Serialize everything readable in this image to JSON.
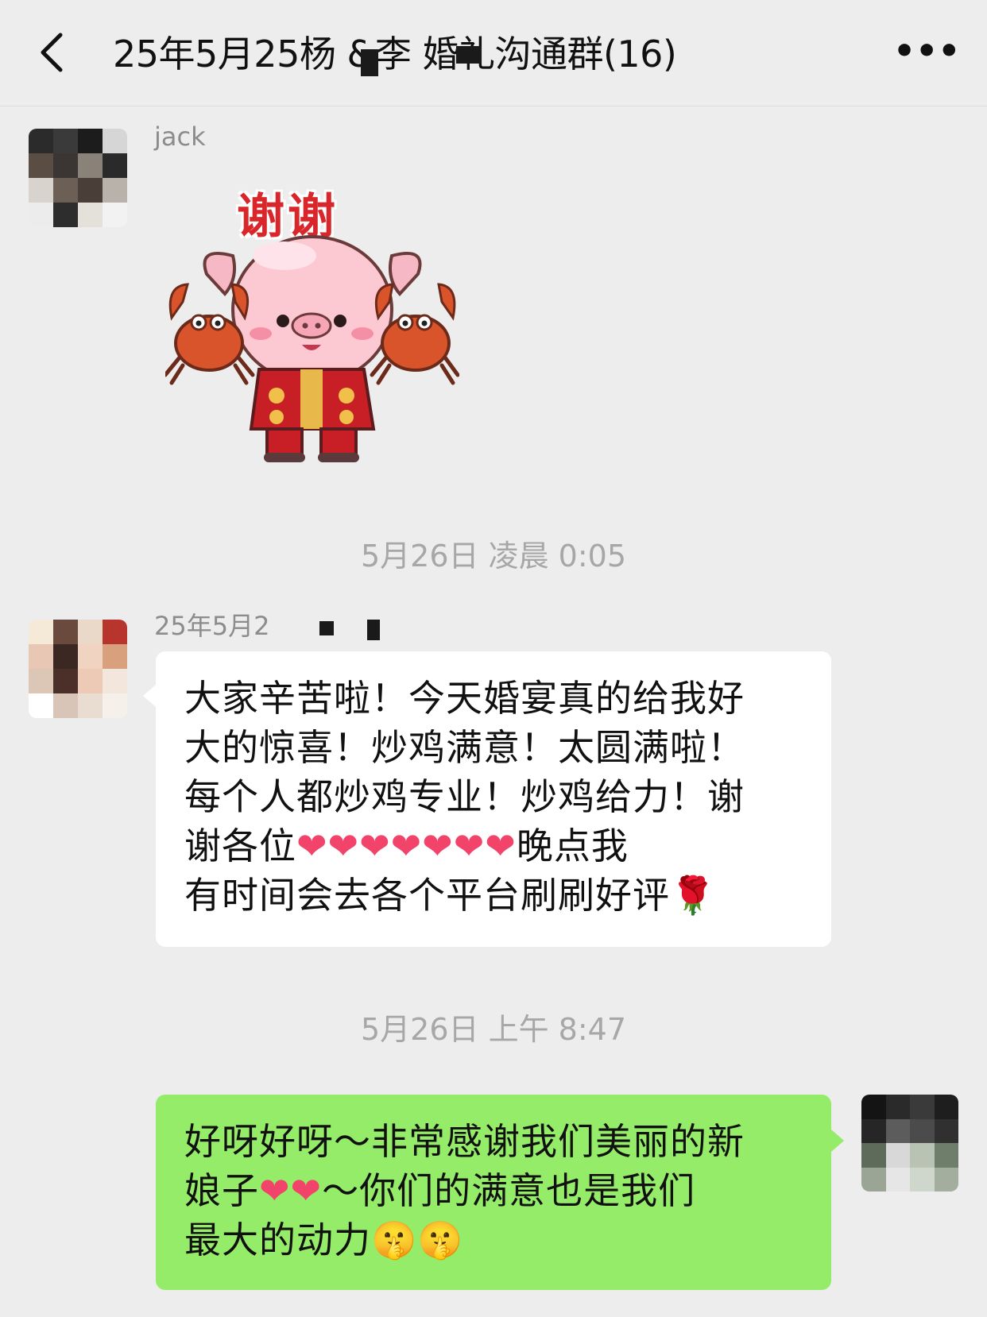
{
  "nav": {
    "back_icon": "chevron-left-icon",
    "title": "25年5月25杨 &李 婚礼沟通群(16)",
    "more_label": "•••"
  },
  "messages": [
    {
      "sender": "jack",
      "type": "sticker",
      "sticker_text": "谢谢",
      "sticker_icon": "pig-with-crabs-sticker"
    },
    {
      "timestamp": "5月26日 凌晨 0:05"
    },
    {
      "sender": "25年5月2",
      "type": "text",
      "line1": "大家辛苦啦！今天婚宴真的给我好",
      "line2": "大的惊喜！炒鸡满意！太圆满啦！",
      "line3": "每个人都炒鸡专业！炒鸡给力！谢",
      "line4a": "谢各位",
      "hearts": "❤❤❤❤❤❤❤",
      "line4b": "晚点我",
      "line5": "有时间会去各个平台刷刷好评",
      "rose": "🌹"
    },
    {
      "timestamp": "5月26日 上午 8:47"
    },
    {
      "type": "text",
      "self": true,
      "line1": "好呀好呀～非常感谢我们美丽的新",
      "line2a": "娘子",
      "hearts": "❤❤",
      "line2b": "～你们的满意也是我们",
      "line3": "最大的动力",
      "emoji": "🤫🤫"
    }
  ],
  "colors": {
    "background": "#ededed",
    "self_bubble": "#95ec69",
    "other_bubble": "#ffffff",
    "heart": "#f2446a",
    "sticker_text": "#d8262b"
  }
}
